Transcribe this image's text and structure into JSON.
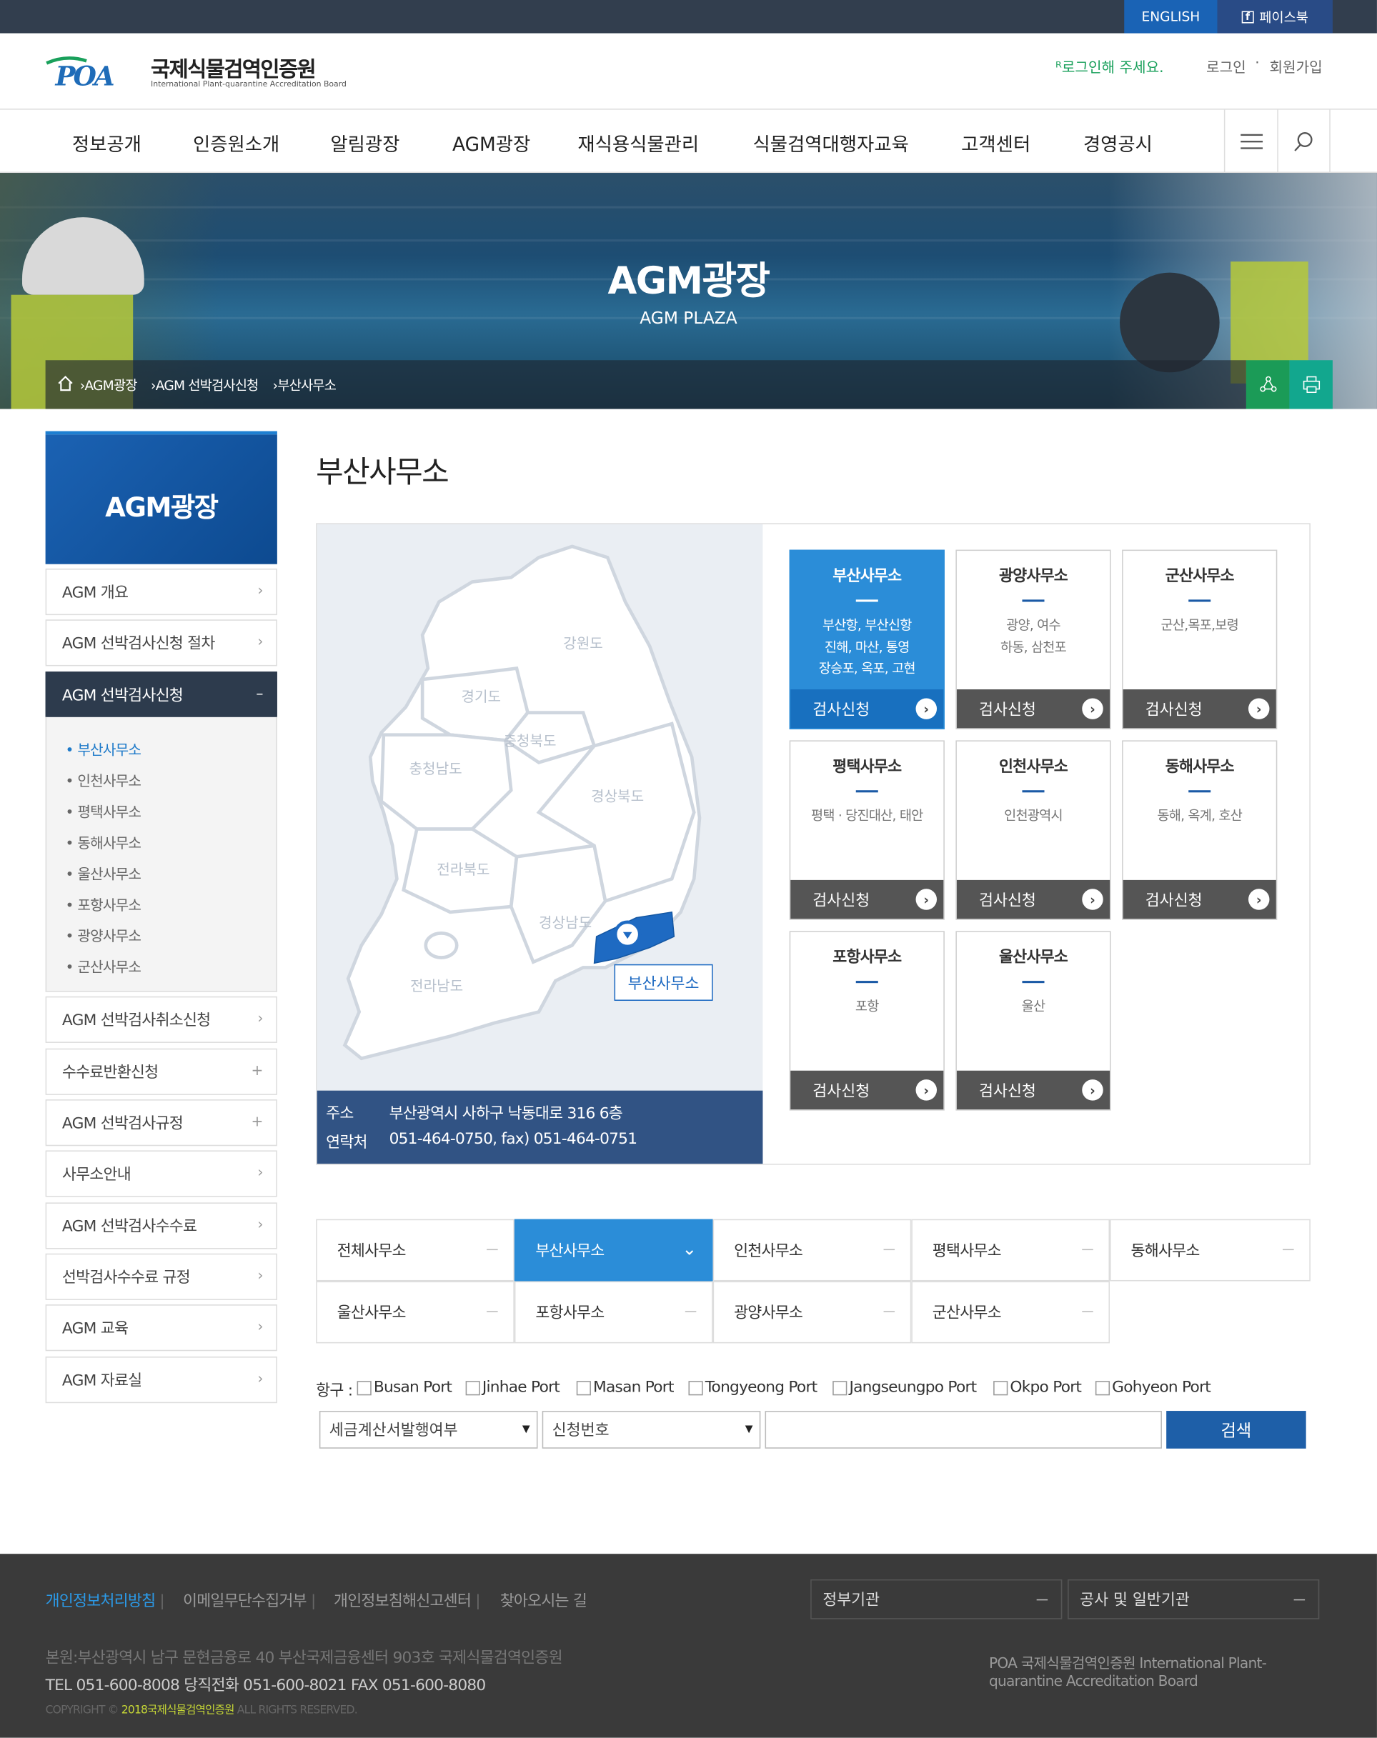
{
  "topbar": {
    "english": "ENGLISH",
    "facebook": "페이스북"
  },
  "header": {
    "logo_mark": "POA",
    "logo_ko": "국제식물검역인증원",
    "logo_en": "International Plant-quarantine Accreditation Board",
    "login_prompt": "로그인해 주세요.",
    "login": "로그인",
    "sep": "·",
    "join": "회원가입"
  },
  "gnb": [
    "정보공개",
    "인증원소개",
    "알림광장",
    "AGM광장",
    "재식용식물관리",
    "식물검역대행자교육",
    "고객센터",
    "경영공시"
  ],
  "hero": {
    "title": "AGM광장",
    "subtitle": "AGM PLAZA",
    "crumbs": [
      "AGM광장",
      "AGM 선박검사신청",
      "부산사무소"
    ]
  },
  "sidebar": {
    "title": "AGM광장",
    "items": [
      {
        "label": "AGM 개요",
        "icon": "›"
      },
      {
        "label": "AGM 선박검사신청 절차",
        "icon": "›"
      },
      {
        "label": "AGM 선박검사신청",
        "icon": "–"
      },
      {
        "label": "AGM 선박검사취소신청",
        "icon": "›"
      },
      {
        "label": "수수료반환신청",
        "icon": "+"
      },
      {
        "label": "AGM 선박검사규정",
        "icon": "+"
      },
      {
        "label": "사무소안내",
        "icon": "›"
      },
      {
        "label": "AGM 선박검사수수료",
        "icon": "›"
      },
      {
        "label": "선박검사수수료 규정",
        "icon": "›"
      },
      {
        "label": "AGM 교육",
        "icon": "›"
      },
      {
        "label": "AGM 자료실",
        "icon": "›"
      }
    ],
    "sub": [
      "부산사무소",
      "인천사무소",
      "평택사무소",
      "동해사무소",
      "울산사무소",
      "포항사무소",
      "광양사무소",
      "군산사무소"
    ]
  },
  "main": {
    "title": "부산사무소",
    "map": {
      "regions": [
        "강원도",
        "경기도",
        "충청북도",
        "충청남도",
        "경상북도",
        "전라북도",
        "경상남도",
        "전라남도"
      ],
      "marker_label": "부산사무소"
    },
    "address": {
      "addr_label": "주소",
      "addr": "부산광역시 사하구 낙동대로 316 6층",
      "tel_label": "연락처",
      "tel": "051-464-0750, fax) 051-464-0751"
    },
    "offices": [
      {
        "name": "부산사무소",
        "area": "부산항, 부산신항\n진해, 마산, 통영\n장승포, 옥포, 고현",
        "btn": "검사신청"
      },
      {
        "name": "광양사무소",
        "area": "광양, 여수\n하동, 삼천포",
        "btn": "검사신청"
      },
      {
        "name": "군산사무소",
        "area": "군산,목포,보령",
        "btn": "검사신청"
      },
      {
        "name": "평택사무소",
        "area": "평택 · 당진대산, 태안",
        "btn": "검사신청"
      },
      {
        "name": "인천사무소",
        "area": "인천광역시",
        "btn": "검사신청"
      },
      {
        "name": "동해사무소",
        "area": "동해, 옥계, 호산",
        "btn": "검사신청"
      },
      {
        "name": "포항사무소",
        "area": "포항",
        "btn": "검사신청"
      },
      {
        "name": "울산사무소",
        "area": "울산",
        "btn": "검사신청"
      }
    ],
    "tabs": [
      "전체사무소",
      "부산사무소",
      "인천사무소",
      "평택사무소",
      "동해사무소",
      "울산사무소",
      "포항사무소",
      "광양사무소",
      "군산사무소"
    ],
    "filter": {
      "label": "항구 :",
      "ports": [
        "Busan Port",
        "Jinhae Port",
        "Masan Port",
        "Tongyeong Port",
        "Jangseungpo Port",
        "Okpo Port",
        "Gohyeon Port"
      ],
      "select1": "세금계산서발행여부",
      "select2": "신청번호",
      "search": "검색"
    }
  },
  "footer": {
    "links": [
      "개인정보처리방침",
      "이메일무단수집거부",
      "개인정보침해신고센터",
      "찾아오시는 길"
    ],
    "sel1": "정부기관",
    "sel2": "공사 및 일반기관",
    "address": "본원:부산광역시 남구 문현금융로 40 부산국제금융센터 903호 국제식물검역인증원",
    "tel": "TEL 051-600-8008 당직전화 051-600-8021 FAX 051-600-8080",
    "copy_pre": "COPYRIGHT ©",
    "copy_year": "2018국제식물검역인증원",
    "copy_post": "ALL RIGHTS RESERVED.",
    "logo_alt": "POA 국제식물검역인증원 International Plant-quarantine Accreditation Board"
  },
  "colors": {
    "accent": "#2b8dd8",
    "navy": "#315384",
    "topbar": "#323e4e",
    "green": "#19a05b"
  }
}
